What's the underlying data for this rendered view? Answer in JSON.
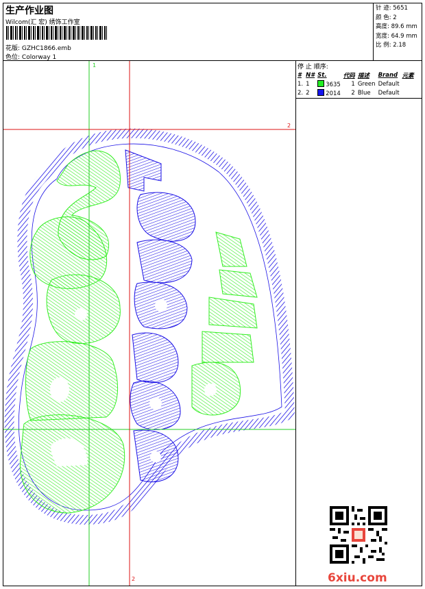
{
  "header": {
    "title": "生产作业图",
    "subtitle": "Wilcom(汇 宏) 绣饰工作室",
    "file_label": "花版:",
    "file_name": "GZHC1866.emb",
    "colorway_label": "色位:",
    "colorway_name": "Colorway 1"
  },
  "stats": {
    "stitches": "针 迹: 5651",
    "colors": "颜 色: 2",
    "height": "高度: 89.6 mm",
    "width": "宽度: 64.9 mm",
    "scale": "比 例: 2.18"
  },
  "stop_sequence": {
    "title": "停 止 顺序:",
    "columns": [
      "#",
      "N#",
      "St.",
      "代码",
      "描述",
      "Brand",
      "元素"
    ],
    "rows": [
      {
        "num": "1.",
        "n": "1",
        "code": "3635",
        "idx": "1",
        "desc": "Green",
        "brand": "Default",
        "color": "#22ee22"
      },
      {
        "num": "2.",
        "n": "2",
        "code": "2014",
        "idx": "2",
        "desc": "Blue",
        "brand": "Default",
        "color": "#1515ee"
      }
    ]
  },
  "guides": {
    "green_top_label": "1",
    "red_right_label": "2",
    "red_bottom_label": "2",
    "green_color": "#22cc22",
    "red_color": "#dd1111"
  },
  "design": {
    "green_word": "CROSS",
    "blue_word_1": "COUNTRY",
    "blue_word_2": "CHEER",
    "green_color": "#33ee22",
    "blue_color": "#1a10e6"
  },
  "watermark": "6xiu.com"
}
